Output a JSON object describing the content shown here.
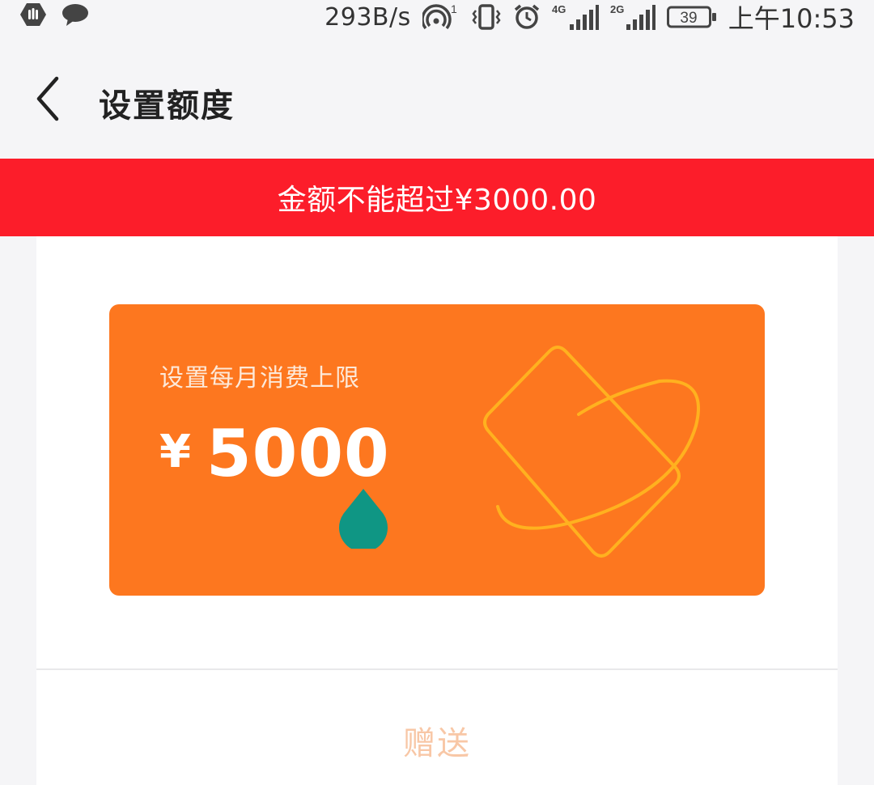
{
  "status_bar": {
    "net_speed": "293B/s",
    "battery": "39",
    "time": "上午10:53",
    "signal_labels": [
      "4G",
      "2G"
    ],
    "hotspot_badge": "1",
    "icons": [
      "hand-icon",
      "chat-bubble-icon",
      "wifi-hotspot-icon",
      "vibrate-icon",
      "alarm-icon",
      "signal-4g-icon",
      "signal-2g-icon",
      "battery-icon"
    ]
  },
  "header": {
    "title": "设置额度",
    "back_icon": "chevron-left-icon"
  },
  "error_banner": {
    "message": "金额不能超过¥3000.00",
    "color": "#fc1d2a"
  },
  "limit_card": {
    "label": "设置每月消费上限",
    "currency": "¥",
    "amount": "5000",
    "background": "#fd771f",
    "deco_color": "#ffb11f",
    "handle_color": "#0f9684"
  },
  "gift_button": {
    "label": "赠送",
    "color": "#f8c7a6"
  }
}
